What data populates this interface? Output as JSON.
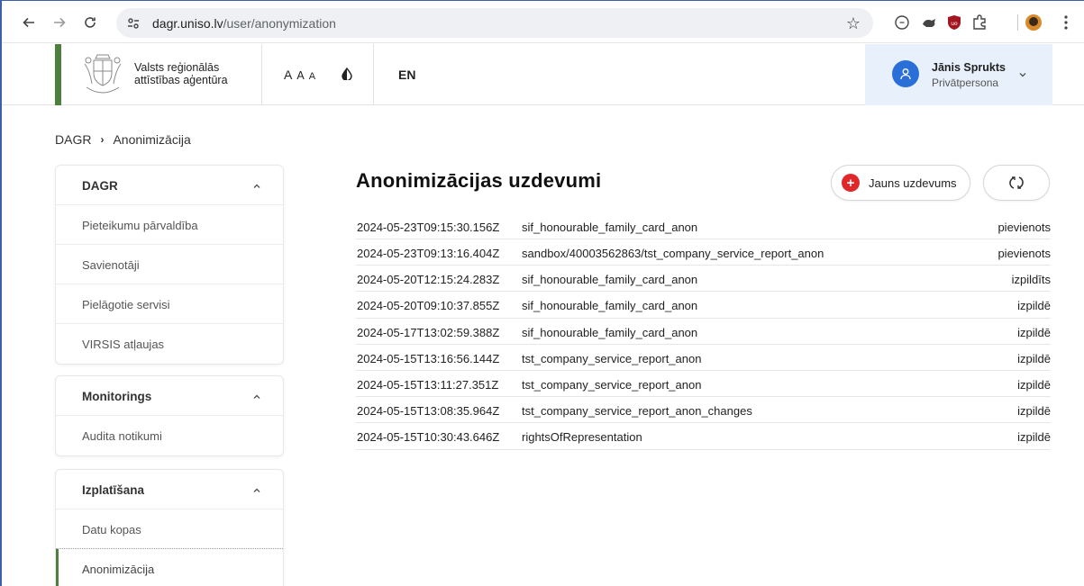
{
  "browser": {
    "url_host": "dagr.uniso.lv",
    "url_path": "/user/anonymization"
  },
  "header": {
    "org_line1": "Valsts reģionālās",
    "org_line2": "attīstības aģentūra",
    "font_size_label": [
      "A",
      "A",
      "A"
    ],
    "language": "EN",
    "user": {
      "name": "Jānis Sprukts",
      "role": "Privātpersona"
    }
  },
  "breadcrumb": {
    "root": "DAGR",
    "current": "Anonimizācija"
  },
  "sidebar": {
    "groups": [
      {
        "title": "DAGR",
        "items": [
          "Pieteikumu pārvaldība",
          "Savienotāji",
          "Pielāgotie servisi",
          "VIRSIS atļaujas"
        ]
      },
      {
        "title": "Monitorings",
        "items": [
          "Audita notikumi"
        ]
      },
      {
        "title": "Izplatīšana",
        "items": [
          "Datu kopas",
          "Anonimizācija"
        ]
      }
    ]
  },
  "main": {
    "title": "Anonimizācijas uzdevumi",
    "new_task_label": "Jauns uzdevums",
    "tasks": [
      {
        "timestamp": "2024-05-23T09:15:30.156Z",
        "name": "sif_honourable_family_card_anon",
        "status": "pievienots"
      },
      {
        "timestamp": "2024-05-23T09:13:16.404Z",
        "name": "sandbox/40003562863/tst_company_service_report_anon",
        "status": "pievienots"
      },
      {
        "timestamp": "2024-05-20T12:15:24.283Z",
        "name": "sif_honourable_family_card_anon",
        "status": "izpildīts"
      },
      {
        "timestamp": "2024-05-20T09:10:37.855Z",
        "name": "sif_honourable_family_card_anon",
        "status": "izpildē"
      },
      {
        "timestamp": "2024-05-17T13:02:59.388Z",
        "name": "sif_honourable_family_card_anon",
        "status": "izpildē"
      },
      {
        "timestamp": "2024-05-15T13:16:56.144Z",
        "name": "tst_company_service_report_anon",
        "status": "izpildē"
      },
      {
        "timestamp": "2024-05-15T13:11:27.351Z",
        "name": "tst_company_service_report_anon",
        "status": "izpildē"
      },
      {
        "timestamp": "2024-05-15T13:08:35.964Z",
        "name": "tst_company_service_report_anon_changes",
        "status": "izpildē"
      },
      {
        "timestamp": "2024-05-15T10:30:43.646Z",
        "name": "rightsOfRepresentation",
        "status": "izpildē"
      }
    ]
  },
  "colors": {
    "accent_green": "#4f7f3e",
    "user_blue": "#2a6fd8",
    "new_button_red": "#e0282a"
  }
}
